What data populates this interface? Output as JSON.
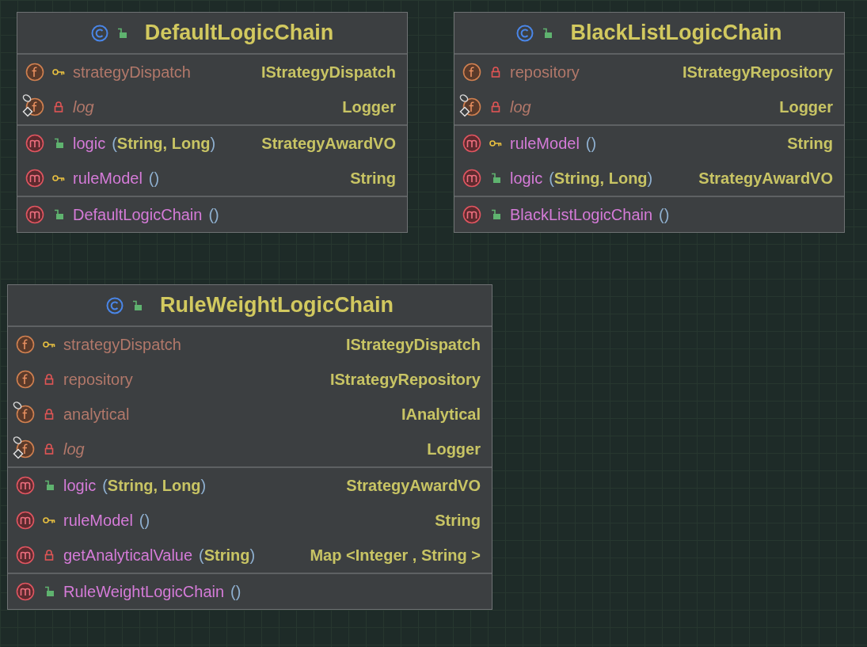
{
  "classes": [
    {
      "name": "DefaultLogicChain",
      "kind": "class",
      "access": {
        "kind": "public"
      },
      "sections": [
        [
          {
            "kind": "field",
            "access": {
              "kind": "protected"
            },
            "name": "strategyDispatch",
            "type": "IStrategyDispatch",
            "static": false,
            "final": false
          },
          {
            "kind": "field",
            "access": {
              "kind": "private"
            },
            "name": "log",
            "type": "Logger",
            "static": true,
            "final": true
          }
        ],
        [
          {
            "kind": "method",
            "access": {
              "kind": "public"
            },
            "name": "logic",
            "params": "(String, Long)",
            "type": "StrategyAwardVO",
            "static": false,
            "final": false
          },
          {
            "kind": "method",
            "access": {
              "kind": "protected"
            },
            "name": "ruleModel",
            "params": "()",
            "type": "String",
            "static": false,
            "final": false
          }
        ],
        [
          {
            "kind": "method",
            "access": {
              "kind": "public"
            },
            "name": "DefaultLogicChain",
            "params": " ()",
            "static": false,
            "final": false
          }
        ]
      ]
    },
    {
      "name": "BlackListLogicChain",
      "kind": "class",
      "access": {
        "kind": "public"
      },
      "sections": [
        [
          {
            "kind": "field",
            "access": {
              "kind": "private"
            },
            "name": "repository",
            "type": "IStrategyRepository",
            "static": false,
            "final": false
          },
          {
            "kind": "field",
            "access": {
              "kind": "private"
            },
            "name": "log",
            "type": "Logger",
            "static": true,
            "final": true
          }
        ],
        [
          {
            "kind": "method",
            "access": {
              "kind": "protected"
            },
            "name": "ruleModel",
            "params": "()",
            "type": "String",
            "static": false,
            "final": false
          },
          {
            "kind": "method",
            "access": {
              "kind": "public"
            },
            "name": "logic",
            "params": "(String, Long)",
            "type": "StrategyAwardVO",
            "static": false,
            "final": false
          }
        ],
        [
          {
            "kind": "method",
            "access": {
              "kind": "public"
            },
            "name": "BlackListLogicChain",
            "params": " ()",
            "static": false,
            "final": false
          }
        ]
      ]
    },
    {
      "name": "RuleWeightLogicChain",
      "kind": "class",
      "access": {
        "kind": "public"
      },
      "sections": [
        [
          {
            "kind": "field",
            "access": {
              "kind": "protected"
            },
            "name": "strategyDispatch",
            "type": "IStrategyDispatch",
            "static": false,
            "final": false
          },
          {
            "kind": "field",
            "access": {
              "kind": "private"
            },
            "name": "repository",
            "type": "IStrategyRepository",
            "static": false,
            "final": false
          },
          {
            "kind": "field",
            "access": {
              "kind": "private"
            },
            "name": "analytical",
            "type": "IAnalytical",
            "static": false,
            "final": true
          },
          {
            "kind": "field",
            "access": {
              "kind": "private"
            },
            "name": "log",
            "type": "Logger",
            "static": true,
            "final": true
          }
        ],
        [
          {
            "kind": "method",
            "access": {
              "kind": "public"
            },
            "name": "logic",
            "params": "(String, Long)",
            "type": "StrategyAwardVO",
            "static": false,
            "final": false
          },
          {
            "kind": "method",
            "access": {
              "kind": "protected"
            },
            "name": "ruleModel",
            "params": "()",
            "type": "String",
            "static": false,
            "final": false
          },
          {
            "kind": "method",
            "access": {
              "kind": "private"
            },
            "name": "getAnalyticalValue",
            "params": "(String)",
            "type": "Map <Integer , String >",
            "static": false,
            "final": false
          }
        ],
        [
          {
            "kind": "method",
            "access": {
              "kind": "public"
            },
            "name": "RuleWeightLogicChain",
            "params": " ()",
            "static": false,
            "final": false
          }
        ]
      ]
    }
  ]
}
